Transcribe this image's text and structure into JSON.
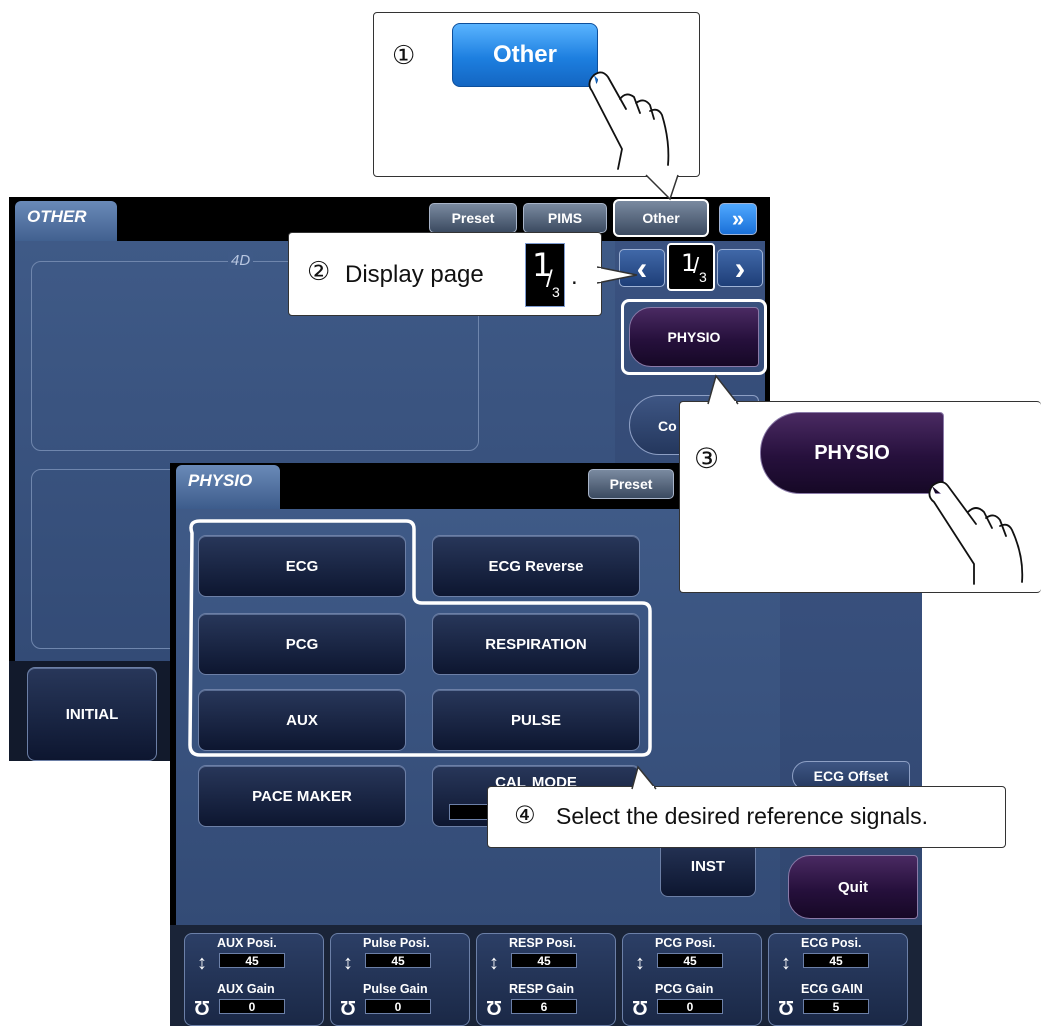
{
  "callouts": {
    "step1": {
      "number": "①",
      "button_label": "Other"
    },
    "step2": {
      "number": "②",
      "text": "Display page",
      "page_current": "1",
      "page_total": "3",
      "suffix": "."
    },
    "step3": {
      "number": "③",
      "button_label": "PHYSIO"
    },
    "step4": {
      "number": "④",
      "text": "Select the desired reference signals."
    }
  },
  "other_panel": {
    "tab_title": "OTHER",
    "top_buttons": {
      "preset": "Preset",
      "pims": "PIMS",
      "other": "Other",
      "forward": "»"
    },
    "frame_label": "4D",
    "page_nav": {
      "prev": "‹",
      "current": "1",
      "total": "3",
      "next": "›"
    },
    "physio_button": "PHYSIO",
    "partial_button": "Co",
    "initial_button": "INITIAL"
  },
  "physio_panel": {
    "tab_title": "PHYSIO",
    "preset_button": "Preset",
    "buttons": {
      "ecg": "ECG",
      "ecg_reverse": "ECG Reverse",
      "pcg": "PCG",
      "respiration": "RESPIRATION",
      "aux": "AUX",
      "pulse": "PULSE",
      "pace_maker": "PACE MAKER",
      "cali_mode_partial_left": "CAL",
      "cali_mode_partial_right": "MODE",
      "inst": "INST",
      "ecg_offset": "ECG Offset",
      "quit": "Quit"
    }
  },
  "controls": [
    {
      "posi_label": "AUX Posi.",
      "posi_value": "45",
      "gain_label": "AUX Gain",
      "gain_value": "0"
    },
    {
      "posi_label": "Pulse Posi.",
      "posi_value": "45",
      "gain_label": "Pulse Gain",
      "gain_value": "0"
    },
    {
      "posi_label": "RESP Posi.",
      "posi_value": "45",
      "gain_label": "RESP Gain",
      "gain_value": "6"
    },
    {
      "posi_label": "PCG Posi.",
      "posi_value": "45",
      "gain_label": "PCG Gain",
      "gain_value": "0"
    },
    {
      "posi_label": "ECG Posi.",
      "posi_value": "45",
      "gain_label": "ECG GAIN",
      "gain_value": "5"
    }
  ],
  "icons": {
    "position": "up-down-arrow-icon",
    "gain": "rotate-knob-icon"
  }
}
